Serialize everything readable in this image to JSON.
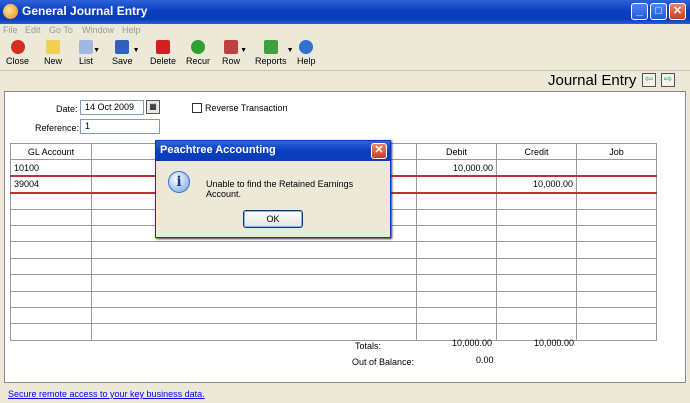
{
  "window": {
    "title": "General Journal Entry",
    "min": "_",
    "max": "□",
    "close": "✕"
  },
  "menu": [
    "File",
    "Edit",
    "Go To",
    "Window",
    "Help"
  ],
  "toolbar": [
    {
      "label": "Close",
      "icon": "close-icon",
      "color": "#d03020"
    },
    {
      "label": "New",
      "icon": "new-icon",
      "color": "#f0d050"
    },
    {
      "label": "List",
      "icon": "list-icon",
      "color": "#a0b8e0"
    },
    {
      "label": "Save",
      "icon": "save-icon",
      "color": "#3060c0"
    },
    {
      "label": "Delete",
      "icon": "delete-icon",
      "color": "#d02020"
    },
    {
      "label": "Recur",
      "icon": "recur-icon",
      "color": "#30a030"
    },
    {
      "label": "Row",
      "icon": "row-icon",
      "color": "#c04040"
    },
    {
      "label": "Reports",
      "icon": "reports-icon",
      "color": "#40a040"
    },
    {
      "label": "Help",
      "icon": "help-icon",
      "color": "#3070d0"
    }
  ],
  "header": {
    "title": "Journal Entry",
    "prev": "⇦",
    "next": "⇨"
  },
  "form": {
    "date_label": "Date:",
    "date_value": "14 Oct 2009",
    "reference_label": "Reference:",
    "reference_value": "1",
    "reverse_label": "Reverse Transaction"
  },
  "table": {
    "columns": [
      "GL Account",
      "",
      "Debit",
      "Credit",
      "Job"
    ],
    "rows": [
      {
        "account": "10100",
        "desc": "",
        "debit": "10,000.00",
        "credit": "",
        "job": ""
      },
      {
        "account": "39004",
        "desc": "",
        "debit": "",
        "credit": "10,000.00",
        "job": ""
      }
    ]
  },
  "totals": {
    "label": "Totals:",
    "debit": "10,000.00",
    "credit": "10,000.00",
    "oob_label": "Out of Balance:",
    "oob_value": "0.00"
  },
  "footer": {
    "link": "Secure remote access to your key business data."
  },
  "dialog": {
    "title": "Peachtree Accounting",
    "message": "Unable to find the Retained Earnings Account.",
    "ok": "OK",
    "close": "✕",
    "icon": "i"
  }
}
